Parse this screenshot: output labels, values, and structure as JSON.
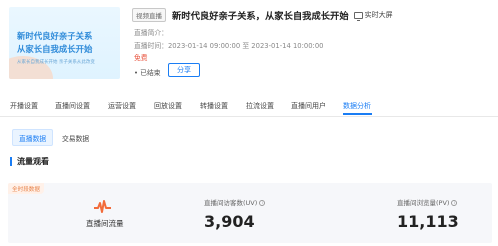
{
  "cover": {
    "line1": "新时代良好亲子关系",
    "line2": "从家长自我成长开始",
    "sub": "从家长自我成长开始 亲子关系从此改变"
  },
  "live": {
    "badge": "视频直播",
    "title": "新时代良好亲子关系，从家长自我成长开始",
    "screen_label": "实时大屏",
    "intro_label": "直播简介：",
    "time_label": "直播时间：",
    "time_value": "2023-01-14 09:00:00 至 2023-01-14 10:00:00",
    "price": "免费",
    "status": "• 已结束",
    "share_label": "分享"
  },
  "tabs": [
    "开播设置",
    "直播间设置",
    "运营设置",
    "回放设置",
    "转播设置",
    "拉流设置",
    "直播间用户",
    "数据分析"
  ],
  "active_tab": 7,
  "subtabs": {
    "live_data": "直播数据",
    "chat_data": "交易数据"
  },
  "section_title": "流量观看",
  "flow": {
    "tag": "全时段数据",
    "label": "直播间流量",
    "uv_label": "直播间访客数(UV)",
    "uv_value": "3,904",
    "pv_label": "直播间浏览量(PV)",
    "pv_value": "11,113"
  },
  "colors": {
    "accent": "#1a7df4",
    "price": "#e8503a",
    "pulse": "#f26b3a"
  }
}
